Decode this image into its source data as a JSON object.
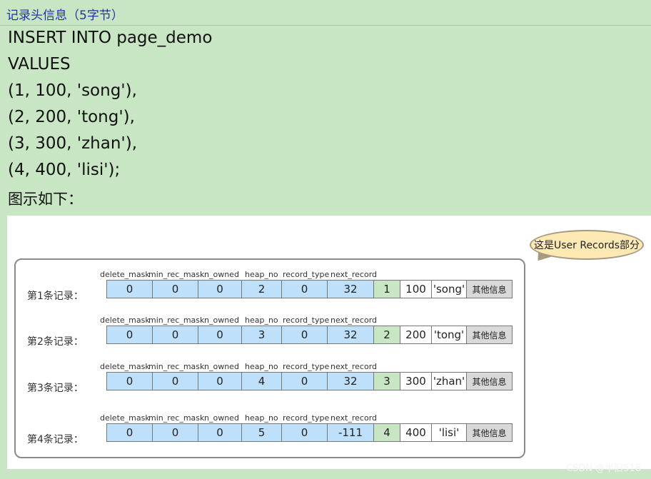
{
  "heading": "记录头信息（5字节）",
  "code_lines": [
    "INSERT INTO page_demo",
    "VALUES",
    "(1, 100, 'song'),",
    "(2, 200, 'tong'),",
    "(3, 300, 'zhan'),",
    "(4, 400, 'lisi');"
  ],
  "caption": "图示如下：",
  "figure": {
    "bubble_text": "这是User Records部分",
    "field_names": [
      "delete_mask",
      "min_rec_mask",
      "n_owned",
      "heap_no",
      "record_type",
      "next_record"
    ],
    "records": [
      {
        "label": "第1条记录：",
        "header": [
          "0",
          "0",
          "0",
          "2",
          "0",
          "32"
        ],
        "id": "1",
        "num": "100",
        "str": "'song'",
        "other": "其他信息"
      },
      {
        "label": "第2条记录：",
        "header": [
          "0",
          "0",
          "0",
          "3",
          "0",
          "32"
        ],
        "id": "2",
        "num": "200",
        "str": "'tong'",
        "other": "其他信息"
      },
      {
        "label": "第3条记录：",
        "header": [
          "0",
          "0",
          "0",
          "4",
          "0",
          "32"
        ],
        "id": "3",
        "num": "300",
        "str": "'zhan'",
        "other": "其他信息"
      },
      {
        "label": "第4条记录：",
        "header": [
          "0",
          "0",
          "0",
          "5",
          "0",
          "-111"
        ],
        "id": "4",
        "num": "400",
        "str": "'lisi'",
        "other": "其他信息"
      }
    ]
  },
  "watermark": "CSDN @半旧518",
  "colors": {
    "background": "#c8e6c4",
    "heading_text": "#2233aa",
    "header_cell": "#bfe0fb",
    "id_cell": "#c8e6c4",
    "other_cell": "#d9d9d9",
    "bubble": "#fde9b4"
  }
}
